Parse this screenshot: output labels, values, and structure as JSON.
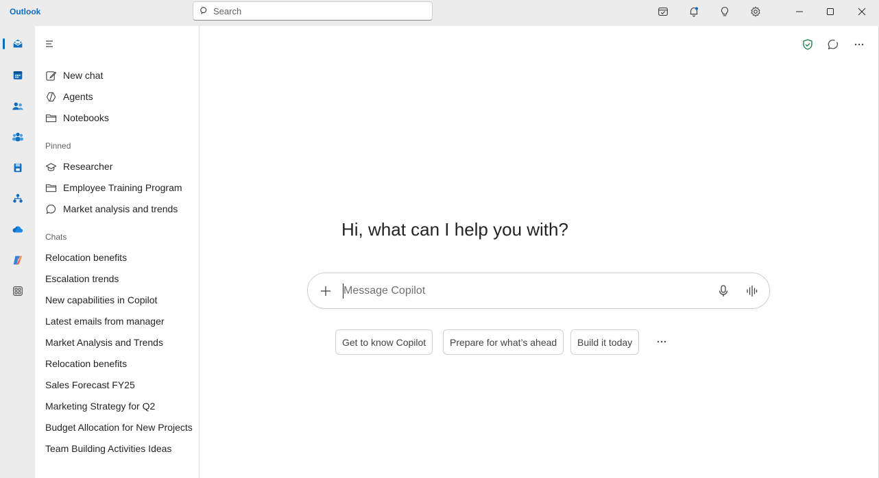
{
  "app": {
    "title": "Outlook"
  },
  "search": {
    "placeholder": "Search"
  },
  "titlebar_icons": [
    "todo-icon",
    "bell-icon",
    "lightbulb-icon",
    "gear-icon"
  ],
  "window_controls": [
    "minimize-icon",
    "maximize-icon",
    "close-icon"
  ],
  "rail": {
    "items": [
      {
        "name": "mail",
        "icon": "mail-icon",
        "active": true
      },
      {
        "name": "calendar",
        "icon": "calendar-icon"
      },
      {
        "name": "people",
        "icon": "people-icon"
      },
      {
        "name": "groups",
        "icon": "groups-icon"
      },
      {
        "name": "files",
        "icon": "files-icon"
      },
      {
        "name": "org",
        "icon": "org-icon"
      },
      {
        "name": "onedrive",
        "icon": "cloud-icon"
      },
      {
        "name": "copilot",
        "icon": "copilot-icon"
      },
      {
        "name": "apps",
        "icon": "apps-icon"
      }
    ]
  },
  "sidebar": {
    "nav": [
      {
        "label": "New chat",
        "icon": "compose-icon"
      },
      {
        "label": "Agents",
        "icon": "agents-icon"
      },
      {
        "label": "Notebooks",
        "icon": "folder-icon"
      }
    ],
    "pinned_label": "Pinned",
    "pinned": [
      {
        "label": "Researcher",
        "icon": "researcher-icon"
      },
      {
        "label": "Employee Training Program",
        "icon": "folder-icon"
      },
      {
        "label": "Market analysis and trends",
        "icon": "chat-bubble-icon"
      }
    ],
    "chats_label": "Chats",
    "chats": [
      "Relocation benefits",
      "Escalation trends",
      "New capabilities in Copilot",
      "Latest emails from manager",
      "Market Analysis and Trends",
      "Relocation benefits",
      "Sales Forecast FY25",
      "Marketing Strategy for Q2",
      "Budget Allocation for New Projects",
      "Team Building Activities Ideas"
    ]
  },
  "main": {
    "greeting": "Hi, what can I help you with?",
    "composer_placeholder": "Message Copilot",
    "suggestions": [
      "Get to know Copilot",
      "Prepare for what’s ahead",
      "Build it today"
    ],
    "top_actions": [
      "shield-check-icon",
      "new-chat-icon",
      "more-icon"
    ]
  },
  "colors": {
    "accent": "#0f6cbd",
    "shield": "#107c41"
  }
}
